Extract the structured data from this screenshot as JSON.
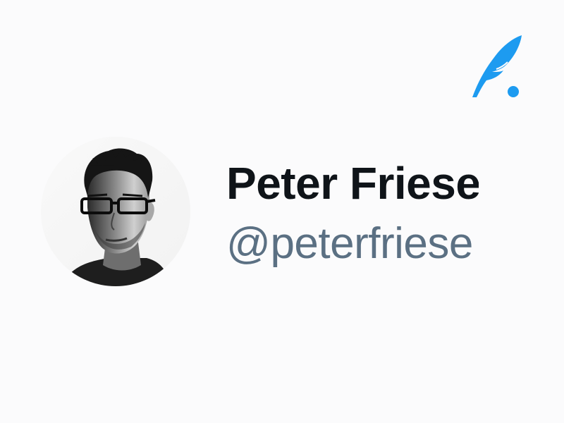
{
  "profile": {
    "display_name": "Peter Friese",
    "handle": "@peterfriese"
  },
  "colors": {
    "background": "#fbfbfc",
    "name": "#0f1419",
    "handle": "#5b7083",
    "accent": "#1d9bf0"
  },
  "icons": {
    "brand_logo": "feather-quill-logo",
    "avatar": "profile-photo"
  }
}
